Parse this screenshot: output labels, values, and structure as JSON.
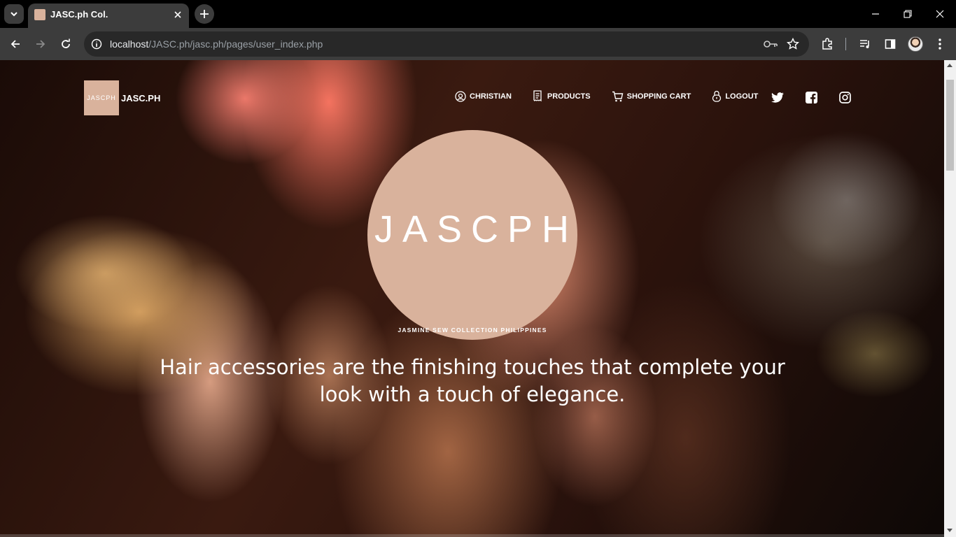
{
  "browser": {
    "tab_title": "JASC.ph Col.",
    "url_host": "localhost",
    "url_path": "/JASC.ph/jasc.ph/pages/user_index.php"
  },
  "site": {
    "brand_logo_text": "JASCPH",
    "brand_name": "JASC.PH",
    "nav": {
      "user": "CHRISTIAN",
      "products": "PRODUCTS",
      "cart": "SHOPPING CART",
      "logout": "LOGOUT"
    },
    "hero": {
      "logo_title": "JASCPH",
      "logo_subtitle": "JASMINE SEW COLLECTION PHILIPPINES",
      "tagline": "Hair accessories are the finishing touches that complete your look with a touch of elegance."
    }
  },
  "colors": {
    "brand": "#d9b29c",
    "chrome_bg": "#3c3c3c",
    "tab_strip": "#000000"
  },
  "icons": [
    "tab-search-icon",
    "close-icon",
    "plus-icon",
    "minimize-icon",
    "restore-icon",
    "back-icon",
    "forward-icon",
    "reload-icon",
    "info-icon",
    "key-icon",
    "star-icon",
    "extensions-icon",
    "media-icon",
    "side-panel-icon",
    "menu-icon",
    "user-icon",
    "receipt-icon",
    "cart-icon",
    "lock-icon",
    "twitter-icon",
    "facebook-icon",
    "instagram-icon"
  ]
}
